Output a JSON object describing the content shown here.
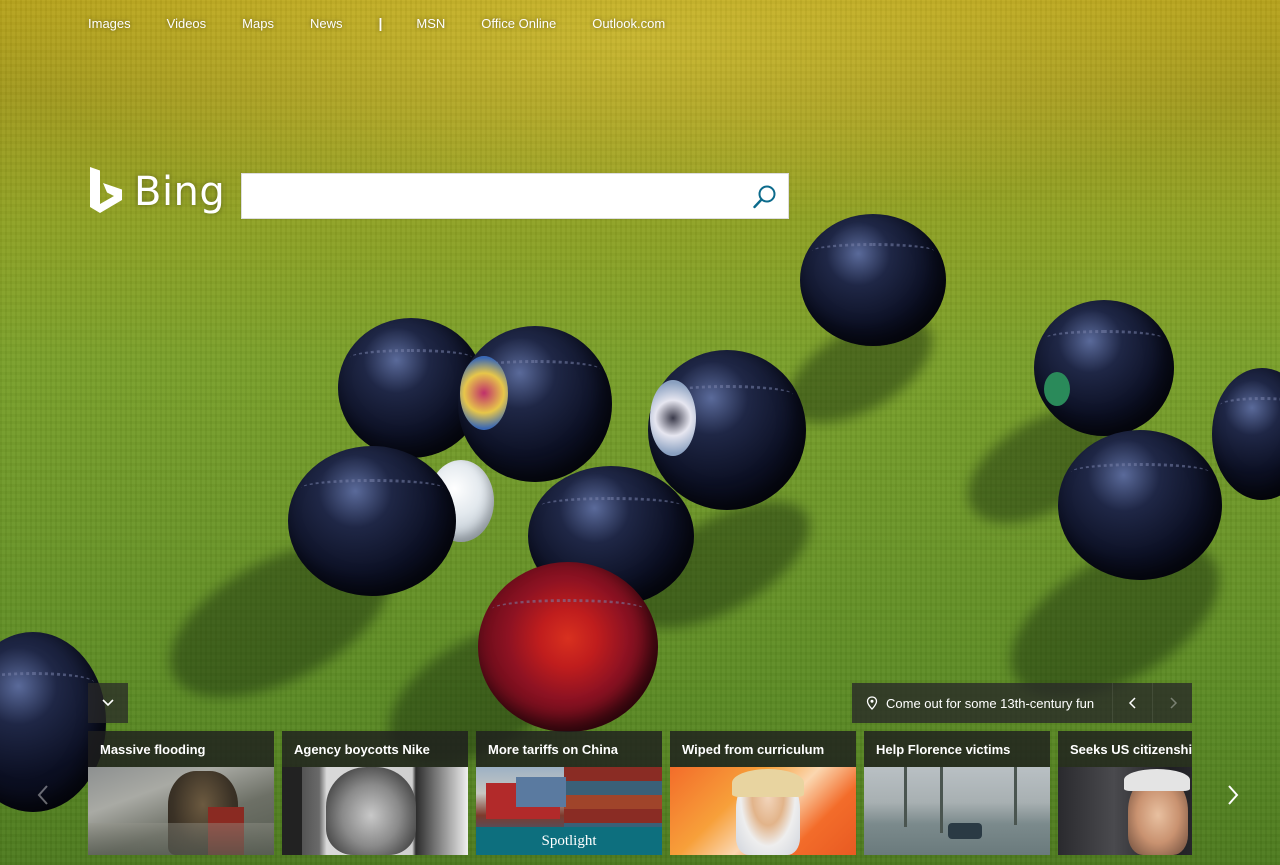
{
  "nav": {
    "links": [
      "Images",
      "Videos",
      "Maps",
      "News"
    ],
    "separator": "|",
    "links2": [
      "MSN",
      "Office Online",
      "Outlook.com"
    ]
  },
  "logo": {
    "text": "Bing"
  },
  "search": {
    "value": "",
    "icon": "search-icon"
  },
  "image_caption": {
    "text": "Come out for some 13th-century fun",
    "icon": "location-pin-icon"
  },
  "news_tiles": [
    {
      "title": "Massive flooding"
    },
    {
      "title": "Agency boycotts Nike"
    },
    {
      "title": "More tariffs on China",
      "badge": "Spotlight"
    },
    {
      "title": "Wiped from curriculum"
    },
    {
      "title": "Help Florence victims"
    },
    {
      "title": "Seeks US citizenship"
    }
  ],
  "colors": {
    "spotlight_badge": "#0d6f7e",
    "search_icon": "#0c6b8c",
    "overlay": "#282828"
  }
}
